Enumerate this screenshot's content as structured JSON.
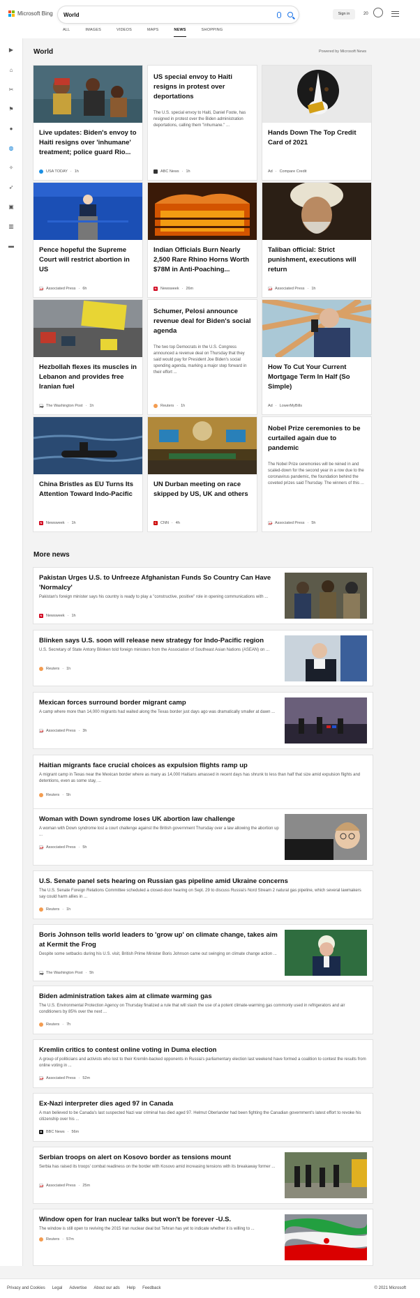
{
  "header": {
    "brand": "Microsoft Bing",
    "search_value": "World",
    "signin": "Sign in",
    "points": "20",
    "tabs": [
      "ALL",
      "IMAGES",
      "VIDEOS",
      "MAPS",
      "NEWS",
      "SHOPPING"
    ],
    "active_tab": "NEWS"
  },
  "section": {
    "title": "World",
    "powered": "Powered by Microsoft News"
  },
  "cards": [
    {
      "title": "Live updates: Biden's envoy to Haiti resigns over 'inhumane' treatment; police guard Rio...",
      "desc": "",
      "source": "USA TODAY",
      "time": "1h",
      "ad": false
    },
    {
      "title": "US special envoy to Haiti resigns in protest over deportations",
      "desc": "The U.S. special envoy to Haiti, Daniel Foote, has resigned in protest over the Biden administration deportations, calling them \"inhumane.\" ...",
      "source": "ABC News",
      "time": "1h",
      "ad": false
    },
    {
      "title": "Hands Down The Top Credit Card of 2021",
      "desc": "",
      "source": "Compare Credit",
      "time": "",
      "ad": true
    },
    {
      "title": "Pence hopeful the Supreme Court will restrict abortion in US",
      "desc": "",
      "source": "Associated Press",
      "time": "6h",
      "ad": false
    },
    {
      "title": "Indian Officials Burn Nearly 2,500 Rare Rhino Horns Worth $78M in Anti-Poaching...",
      "desc": "",
      "source": "Newsweek",
      "time": "26m",
      "ad": false
    },
    {
      "title": "Taliban official: Strict punishment, executions will return",
      "desc": "",
      "source": "Associated Press",
      "time": "1h",
      "ad": false
    },
    {
      "title": "Hezbollah flexes its muscles in Lebanon and provides free Iranian fuel",
      "desc": "",
      "source": "The Washington Post",
      "time": "1h",
      "ad": false
    },
    {
      "title": "Schumer, Pelosi announce revenue deal for Biden's social agenda",
      "desc": "The two top Democrats in the U.S. Congress announced a revenue deal on Thursday that they said would pay for President Joe Biden's social spending agenda, marking a major step forward in their effort ...",
      "source": "Reuters",
      "time": "1h",
      "ad": false
    },
    {
      "title": "How To Cut Your Current Mortgage Term In Half (So Simple)",
      "desc": "",
      "source": "LowerMyBills",
      "time": "",
      "ad": true
    },
    {
      "title": "China Bristles as EU Turns Its Attention Toward Indo-Pacific",
      "desc": "",
      "source": "Newsweek",
      "time": "1h",
      "ad": false
    },
    {
      "title": "UN Durban meeting on race skipped by US, UK and others",
      "desc": "",
      "source": "CNN",
      "time": "4h",
      "ad": false
    },
    {
      "title": "Nobel Prize ceremonies to be curtailed again due to pandemic",
      "desc": "The Nobel Prize ceremonies will be reined in and scaled-down for the second year in a row due to the coronavirus pandemic, the foundation behind the coveted prizes said Thursday. The winners of this ...",
      "source": "Associated Press",
      "time": "5h",
      "ad": false
    }
  ],
  "ad_label": "Ad",
  "more_title": "More news",
  "more_news": [
    {
      "title": "Pakistan Urges U.S. to Unfreeze Afghanistan Funds So Country Can Have 'Normalcy'",
      "desc": "Pakistan's foreign minister says his country is ready to play a \"constructive, positive\" role in opening communications with ...",
      "source": "Newsweek",
      "time": "1h"
    },
    {
      "title": "Blinken says U.S. soon will release new strategy for Indo-Pacific region",
      "desc": "U.S. Secretary of State Antony Blinken told foreign ministers from the Association of Southeast Asian Nations (ASEAN) on ...",
      "source": "Reuters",
      "time": "1h"
    },
    {
      "title": "Mexican forces surround border migrant camp",
      "desc": "A camp where more than 14,000 migrants had waited along the Texas border just days ago was dramatically smaller at dawn ...",
      "source": "Associated Press",
      "time": "3h"
    },
    {
      "title": "Haitian migrants face crucial choices as expulsion flights ramp up",
      "desc": "A migrant camp in Texas near the Mexican border where as many as 14,000 Haitians amassed in recent days has shrunk to less than half that size amid expulsion flights and detentions, even as some stay, ...",
      "source": "Reuters",
      "time": "5h"
    },
    {
      "title": "Woman with Down syndrome loses UK abortion law challenge",
      "desc": "A woman with Down syndrome lost a court challenge against the British government Thursday over a law allowing the abortion up ...",
      "source": "Associated Press",
      "time": "5h"
    },
    {
      "title": "U.S. Senate panel sets hearing on Russian gas pipeline amid Ukraine concerns",
      "desc": "The U.S. Senate Foreign Relations Committee scheduled a closed-door hearing on Sept. 29 to discuss Russia's Nord Stream 2 natural gas pipeline, which several lawmakers say could harm allies in ...",
      "source": "Reuters",
      "time": "1h"
    },
    {
      "title": "Boris Johnson tells world leaders to 'grow up' on climate change, takes aim at Kermit the Frog",
      "desc": "Despite some setbacks during his U.S. visit, British Prime Minister Boris Johnson came out swinging on climate change action ...",
      "source": "The Washington Post",
      "time": "5h"
    },
    {
      "title": "Biden administration takes aim at climate warming gas",
      "desc": "The U.S. Environmental Protection Agency on Thursday finalized a rule that will slash the use of a potent climate-warming gas commonly used in refrigerators and air conditioners by 85% over the next ...",
      "source": "Reuters",
      "time": "7h"
    },
    {
      "title": "Kremlin critics to contest online voting in Duma election",
      "desc": "A group of politicians and activists who lost to their Kremlin-backed opponents in Russia's parliamentary election last weekend have formed a coalition to contest the results from online voting in ...",
      "source": "Associated Press",
      "time": "52m"
    },
    {
      "title": "Ex-Nazi interpreter dies aged 97 in Canada",
      "desc": "A man believed to be Canada's last suspected Nazi war criminal has died aged 97. Helmut Oberlander had been fighting the Canadian government's latest effort to revoke his citizenship over his ...",
      "source": "BBC News",
      "time": "56m"
    },
    {
      "title": "Serbian troops on alert on Kosovo border as tensions mount",
      "desc": "Serbia has raised its troops' combat readiness on the border with Kosovo amid increasing tensions with its breakaway former ...",
      "source": "Associated Press",
      "time": "25m"
    },
    {
      "title": "Window open for Iran nuclear talks but won't be forever -U.S.",
      "desc": "The window is still open to reviving the 2015 Iran nuclear deal but Tehran has yet to indicate whether it is willing to ...",
      "source": "Reuters",
      "time": "57m"
    }
  ],
  "footer": {
    "links": [
      "Privacy and Cookies",
      "Legal",
      "Advertise",
      "About our ads",
      "Help",
      "Feedback"
    ],
    "copyright": "© 2021 Microsoft"
  }
}
